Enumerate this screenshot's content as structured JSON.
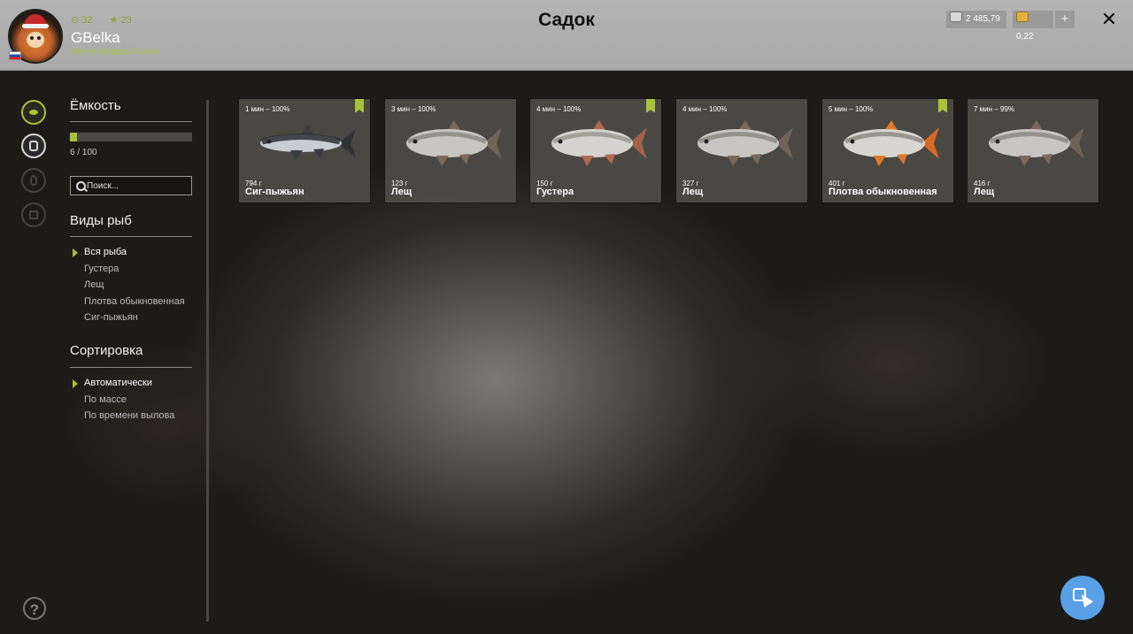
{
  "header": {
    "title": "Садок",
    "player": {
      "stat_level": "32",
      "stat_stars": "23",
      "name": "GBelka",
      "rank": "Мастер фидера 2 ранга"
    },
    "currency": {
      "silver": "2 485,79",
      "gold": "0,22",
      "add_label": "+"
    },
    "close_label": "✕"
  },
  "sidebar": {
    "capacity": {
      "title": "Ёмкость",
      "used": 6,
      "total": 100,
      "fill_fraction": 0.06,
      "text": "6 / 100"
    },
    "search": {
      "placeholder": "Поиск..."
    },
    "species": {
      "title": "Виды рыб",
      "items": [
        "Вся рыба",
        "Густера",
        "Лещ",
        "Плотва обыкновенная",
        "Сиг-пыжьян"
      ],
      "selected_index": 0
    },
    "sort": {
      "title": "Сортировка",
      "items": [
        "Автоматически",
        "По массе",
        "По времени вылова"
      ],
      "selected_index": 0
    },
    "help_label": "?"
  },
  "fish": [
    {
      "time": "1 мин – 100%",
      "weight": "794 г",
      "name": "Сиг-пыжьян",
      "bookmarked": true,
      "kind": "whitefish"
    },
    {
      "time": "3 мин – 100%",
      "weight": "123 г",
      "name": "Лещ",
      "bookmarked": false,
      "kind": "bream"
    },
    {
      "time": "4 мин – 100%",
      "weight": "150 г",
      "name": "Густера",
      "bookmarked": true,
      "kind": "silver-bream"
    },
    {
      "time": "4 мин – 100%",
      "weight": "327 г",
      "name": "Лещ",
      "bookmarked": false,
      "kind": "bream"
    },
    {
      "time": "5 мин – 100%",
      "weight": "401 г",
      "name": "Плотва обыкновенная",
      "bookmarked": true,
      "kind": "roach"
    },
    {
      "time": "7 мин – 99%",
      "weight": "416 г",
      "name": "Лещ",
      "bookmarked": false,
      "kind": "bream"
    }
  ],
  "colors": {
    "accent": "#a8c23a",
    "header_bg": "#b0b0b0",
    "card_bg": "#4e4c48",
    "cursor_button": "#5aa0e6"
  }
}
